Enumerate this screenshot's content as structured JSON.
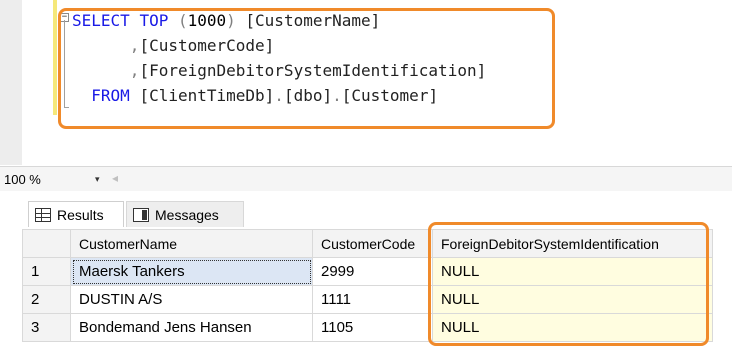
{
  "editor": {
    "lines": [
      {
        "parts": [
          [
            "kw",
            "SELECT "
          ],
          [
            "kw",
            "TOP "
          ],
          [
            "gray",
            "("
          ],
          [
            "num",
            "1000"
          ],
          [
            "gray",
            ") "
          ],
          [
            "txt",
            "[CustomerName]"
          ]
        ]
      },
      {
        "parts": [
          [
            "txt",
            "      "
          ],
          [
            "gray",
            ","
          ],
          [
            "txt",
            "[CustomerCode]"
          ]
        ]
      },
      {
        "parts": [
          [
            "txt",
            "      "
          ],
          [
            "gray",
            ","
          ],
          [
            "txt",
            "[ForeignDebitorSystemIdentification]"
          ]
        ]
      },
      {
        "parts": [
          [
            "txt",
            "  "
          ],
          [
            "kw",
            "FROM "
          ],
          [
            "txt",
            "[ClientTimeDb]"
          ],
          [
            "gray",
            "."
          ],
          [
            "txt",
            "[dbo]"
          ],
          [
            "gray",
            "."
          ],
          [
            "txt",
            "[Customer]"
          ]
        ]
      }
    ],
    "fold_symbol": "−"
  },
  "zoom": {
    "value": "100 %",
    "dropdown_glyph": "▾",
    "scroll_glyph": "◂"
  },
  "tabs": [
    {
      "label": "Results",
      "icon": "grid-icon"
    },
    {
      "label": "Messages",
      "icon": "messages-icon"
    }
  ],
  "results": {
    "columns": [
      "CustomerName",
      "CustomerCode",
      "ForeignDebitorSystemIdentification"
    ],
    "rows": [
      {
        "num": "1",
        "CustomerName": "Maersk Tankers",
        "CustomerCode": "2999",
        "Foreign": "NULL"
      },
      {
        "num": "2",
        "CustomerName": "DUSTIN A/S",
        "CustomerCode": "1111",
        "Foreign": "NULL"
      },
      {
        "num": "3",
        "CustomerName": "Bondemand Jens Hansen",
        "CustomerCode": "1105",
        "Foreign": "NULL"
      }
    ]
  },
  "colors": {
    "highlight": "#f08a2a",
    "keyword": "#1a1ae6"
  }
}
